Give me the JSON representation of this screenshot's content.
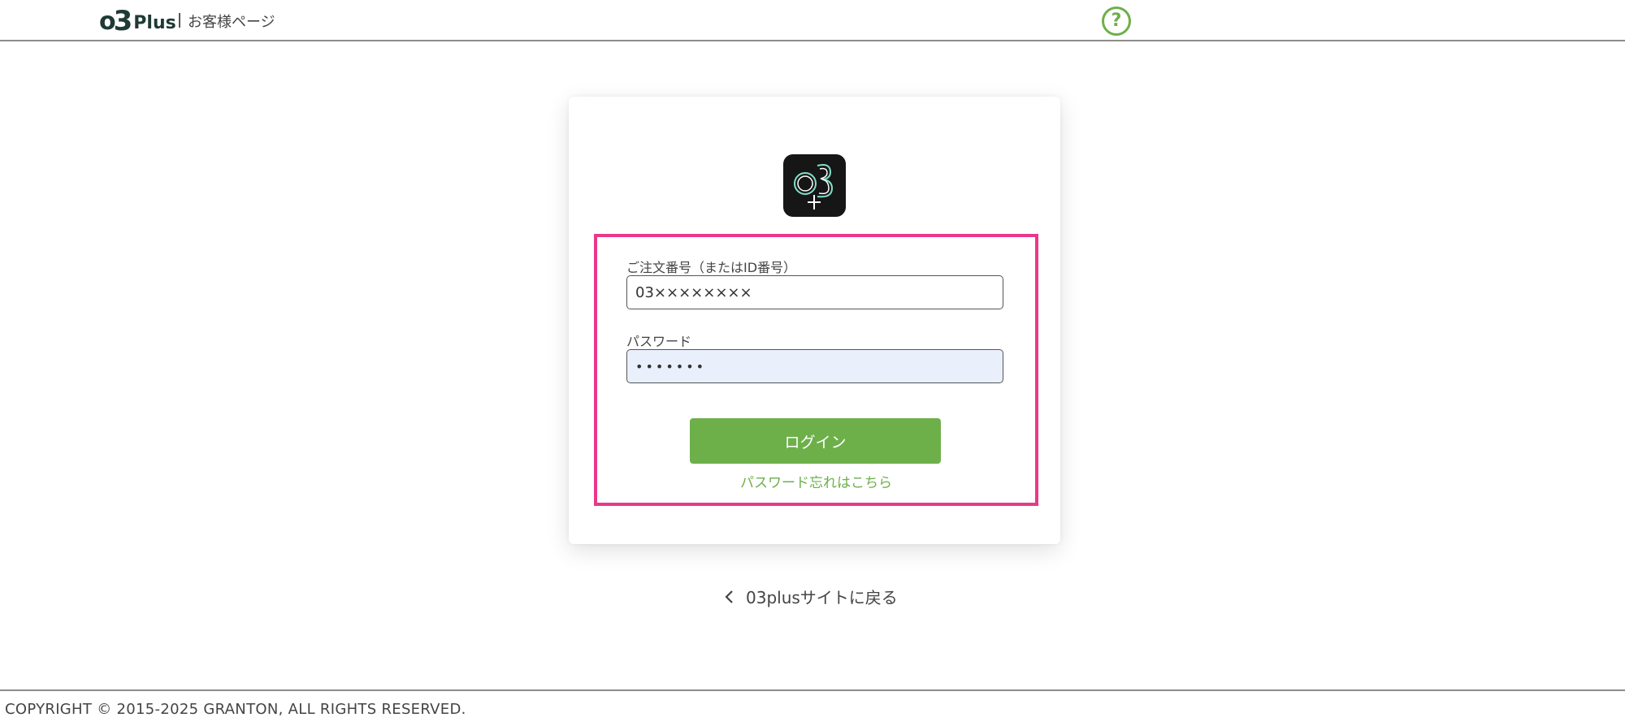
{
  "header": {
    "logo_o": "o",
    "logo_3": "3",
    "logo_plus": "Plus",
    "subtitle": "お客様ページ",
    "help_symbol": "?",
    "help_icon": "help-circle-icon"
  },
  "colors": {
    "accent": "#6db04a",
    "highlight_border": "#e8398a",
    "password_bg": "#eaeffc"
  },
  "login_form": {
    "app_icon": "o3plus-app-icon",
    "order_label": "ご注文番号（またはID番号）",
    "order_value": "03××××××××",
    "password_label": "パスワード",
    "password_value": "•••••••",
    "login_label": "ログイン",
    "forgot_label": "パスワード忘れはこちら"
  },
  "back": {
    "label": "03plusサイトに戻る",
    "icon": "chevron-left-icon"
  },
  "footer": {
    "copyright": "COPYRIGHT © 2015-2025 GRANTON, ALL RIGHTS RESERVED."
  }
}
